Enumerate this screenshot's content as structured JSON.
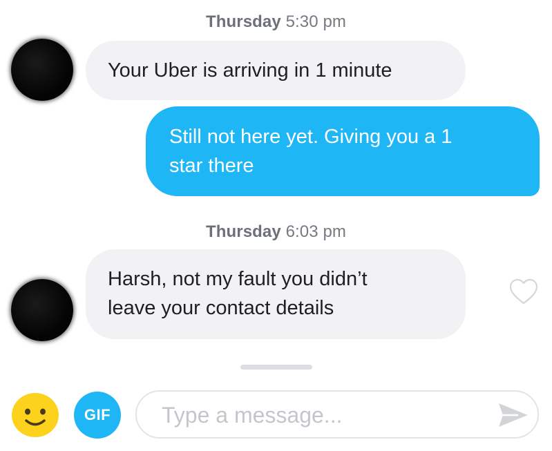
{
  "conversation": {
    "first_group": {
      "timestamp_day": "Thursday",
      "timestamp_time": "5:30 pm",
      "incoming_message": "Your Uber is arriving in 1 minute",
      "outgoing_line1": "Still not here yet. Giving you a 1",
      "outgoing_line2": "star there"
    },
    "second_group": {
      "timestamp_day": "Thursday",
      "timestamp_time": "6:03 pm",
      "incoming_line1": "Harsh, not my fault you didn’t",
      "incoming_line2": "leave your contact details"
    }
  },
  "composer": {
    "emoji_icon": "smiley-icon",
    "gif_label": "GIF",
    "placeholder": "Type a message...",
    "send_icon": "send-arrow-icon"
  },
  "colors": {
    "outgoing_bubble": "#1fb6f6",
    "incoming_bubble": "#f2f2f4",
    "emoji_yellow": "#fcd21d"
  }
}
